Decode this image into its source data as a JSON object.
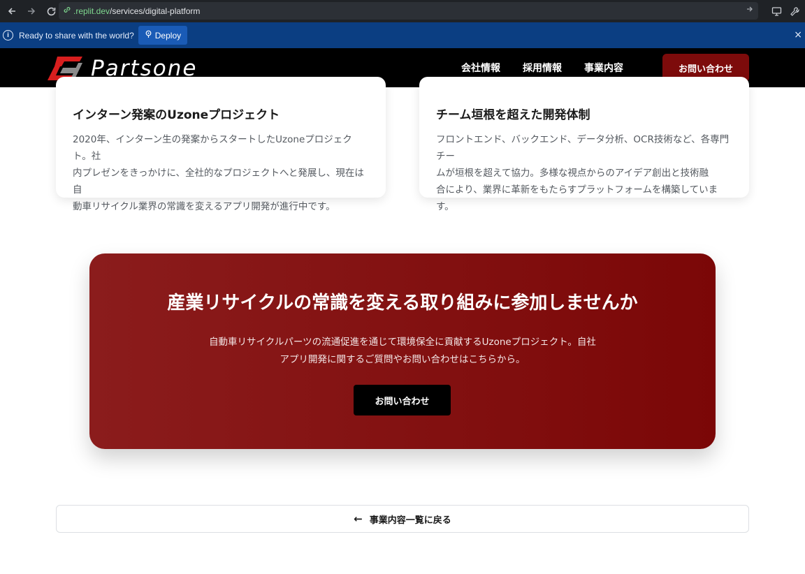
{
  "browser": {
    "url_domain": ".replit.dev",
    "url_path": "/services/digital-platform",
    "icons": [
      "back-arrow-icon",
      "forward-arrow-icon",
      "reload-icon",
      "link-icon",
      "go-arrow-icon",
      "monitor-icon",
      "wrench-icon"
    ]
  },
  "replit_bar": {
    "message": "Ready to share with the world?",
    "deploy_label": "Deploy",
    "close_glyph": "×"
  },
  "header": {
    "logo_text": "Partsone",
    "nav": [
      "会社情報",
      "採用情報",
      "事業内容"
    ],
    "cta_label": "お問い合わせ",
    "colors": {
      "background": "#000000",
      "cta": "#7d0b0b"
    }
  },
  "cards": [
    {
      "title": "インターン発案のUzoneプロジェクト",
      "lines": [
        "2020年、インターン生の発案からスタートしたUzoneプロジェクト。社",
        "内プレゼンをきっかけに、全社的なプロジェクトへと発展し、現在は自",
        "動車リサイクル業界の常識を変えるアプリ開発が進行中です。"
      ]
    },
    {
      "title": "チーム垣根を超えた開発体制",
      "lines": [
        "フロントエンド、バックエンド、データ分析、OCR技術など、各専門チー",
        "ムが垣根を超えて協力。多様な視点からのアイデア創出と技術融",
        "合により、業界に革新をもたらすプラットフォームを構築しています。"
      ]
    }
  ],
  "cta": {
    "heading": "産業リサイクルの常識を変える取り組みに参加しませんか",
    "lines": [
      "自動車リサイクルパーツの流通促進を通じて環境保全に貢献するUzoneプロジェクト。自社",
      "アプリ開発に関するご質問やお問い合わせはこちらから。"
    ],
    "button_label": "お問い合わせ",
    "colors": {
      "gradient_start": "#8b1c1c",
      "gradient_end": "#7b0707"
    }
  },
  "back": {
    "arrow": "←",
    "label": "事業内容一覧に戻る"
  }
}
